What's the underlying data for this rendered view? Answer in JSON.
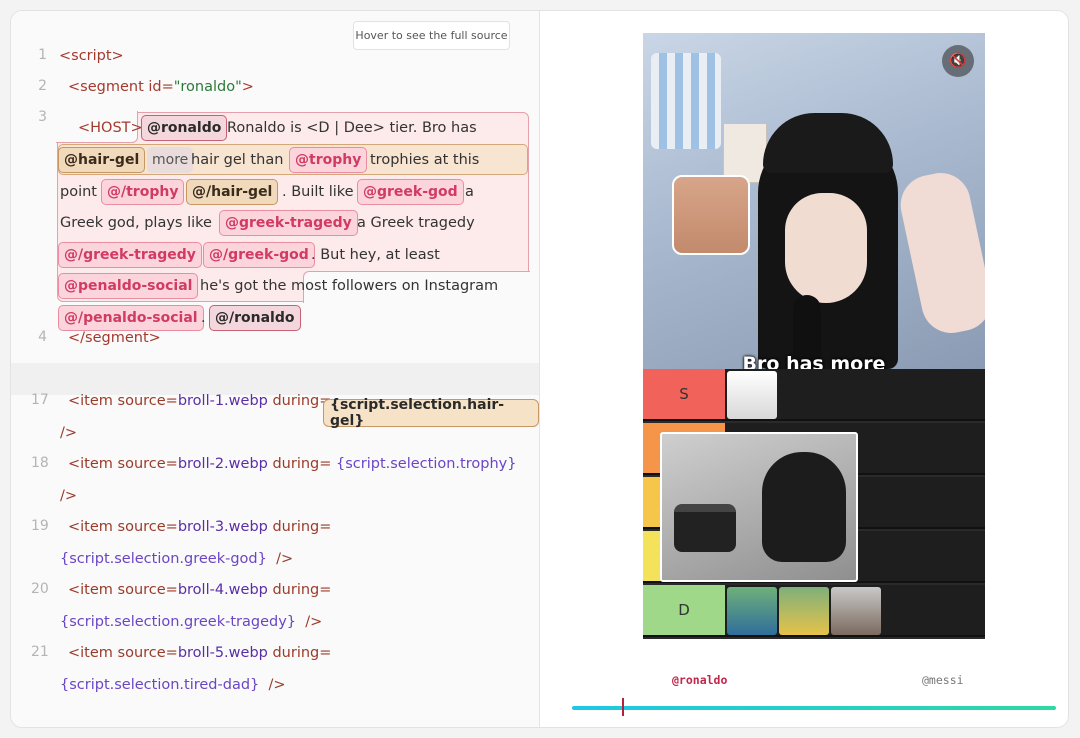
{
  "tooltip": "Hover to see the full source",
  "lines": {
    "n1": "1",
    "n2": "2",
    "n3": "3",
    "n4": "4",
    "n17": "17",
    "n18": "18",
    "n19": "19",
    "n20": "20",
    "n21": "21",
    "l1": "<script>",
    "l2_open": "<segment id=",
    "l2_id": "\"ronaldo\"",
    "l2_close": ">",
    "l3_host": "<HOST>",
    "l4": "</segment>"
  },
  "host_text": {
    "chip_ronaldo": "@ronaldo",
    "t1": "Ronaldo is <D | Dee> tier. Bro has",
    "chip_hairgel": "@hair-gel",
    "chip_more": "more",
    "t2": "hair gel than",
    "chip_trophy": "@trophy",
    "t3": "trophies at this",
    "t4": "point",
    "chip_trophy_end": "@/trophy",
    "chip_hairgel_end": "@/hair-gel",
    "t5": ". Built like",
    "chip_greekgod": "@greek-god",
    "t6": "a",
    "t7": "Greek god, plays like",
    "chip_greektragedy": "@greek-tragedy",
    "t8": "a Greek tragedy",
    "chip_greektragedy_end": "@/greek-tragedy",
    "chip_greekgod_end": "@/greek-god",
    "t9": ". But hey, at least",
    "chip_penaldo": "@penaldo-social",
    "t10": "he's got the most followers on Instagram",
    "chip_penaldo_end": "@/penaldo-social",
    "t11": ".",
    "chip_ronaldo_end": "@/ronaldo"
  },
  "items": [
    {
      "kw": "<item source=",
      "src": "broll-1.webp",
      "during": "during=",
      "sel": "{script.selection.hair-gel}",
      "close": "/>"
    },
    {
      "kw": "<item source=",
      "src": "broll-2.webp",
      "during": "during=",
      "sel": "{script.selection.trophy}",
      "close": "/>"
    },
    {
      "kw": "<item source=",
      "src": "broll-3.webp",
      "during": "during=",
      "sel": "{script.selection.greek-god}",
      "close": "/>"
    },
    {
      "kw": "<item source=",
      "src": "broll-4.webp",
      "during": "during=",
      "sel": "{script.selection.greek-tragedy}",
      "close": "/>"
    },
    {
      "kw": "<item source=",
      "src": "broll-5.webp",
      "during": "during=",
      "sel": "{script.selection.tired-dad}",
      "close": "/>"
    }
  ],
  "video": {
    "caption": "Bro has more",
    "tiers": [
      "S",
      "",
      "",
      "",
      "D"
    ],
    "tier_colors": [
      "#f0625a",
      "#f5954a",
      "#f6c64a",
      "#f4e25a",
      "#9ed888"
    ],
    "mute_icon": "🔇"
  },
  "timeline": {
    "speaker_active": "@ronaldo",
    "speaker_next": "@messi",
    "active_color": "#c2264a"
  }
}
